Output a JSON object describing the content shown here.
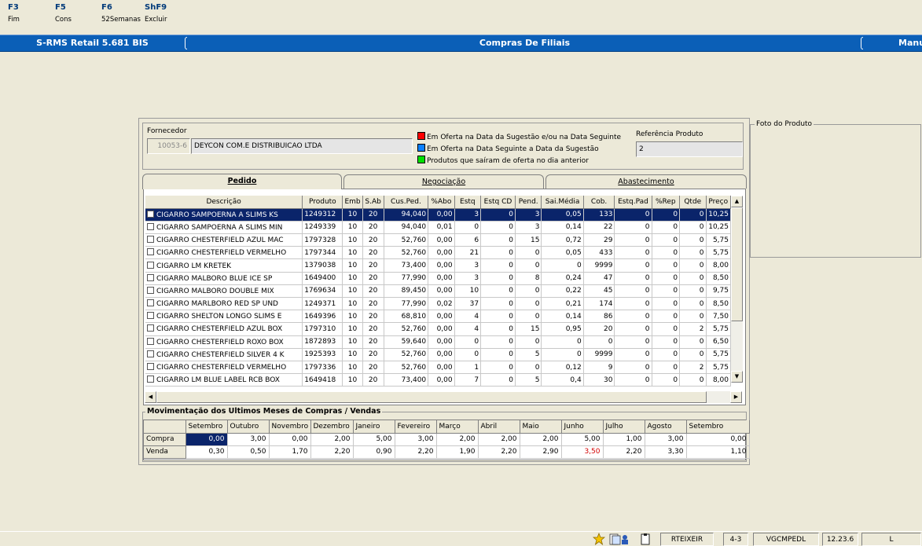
{
  "fkeys": [
    {
      "key": "F3",
      "label": "Fim"
    },
    {
      "key": "F5",
      "label": "Cons"
    },
    {
      "key": "F6",
      "label": "52Semanas"
    },
    {
      "key": "ShF9",
      "label": "Excluir"
    }
  ],
  "titlebar": {
    "app": "S-RMS Retail 5.681 BIS",
    "screen": "Compras De Filiais",
    "right": "Manu"
  },
  "fornecedor": {
    "label": "Fornecedor",
    "code": "10053-6",
    "name": "DEYCON COM.E DISTRIBUICAO LTDA"
  },
  "legend": [
    {
      "color": "#ff0000",
      "text": "Em Oferta na Data da Sugestão e/ou na Data Seguinte"
    },
    {
      "color": "#0a7fff",
      "text": "Em Oferta na Data Seguinte a Data da Sugestão"
    },
    {
      "color": "#00e000",
      "text": "Produtos que saíram de oferta no dia anterior"
    }
  ],
  "referencia": {
    "label": "Referência Produto",
    "value": "2"
  },
  "foto": {
    "label": "Foto do Produto"
  },
  "tabs": [
    "Pedido",
    "Negociação",
    "Abastecimento"
  ],
  "grid": {
    "columns": [
      "Descrição",
      "Produto",
      "Emb",
      "S.Ab",
      "Cus.Ped.",
      "%Abo",
      "Estq",
      "Estq CD",
      "Pend.",
      "Sai.Média",
      "Cob.",
      "Estq.Pad",
      "%Rep",
      "Qtde",
      "Preço"
    ],
    "rows": [
      [
        "CIGARRO SAMPOERNA A SLIMS KS",
        "1249312",
        "10",
        "20",
        "94,040",
        "0,00",
        "3",
        "0",
        "3",
        "0,05",
        "133",
        "0",
        "0",
        "0",
        "10,25"
      ],
      [
        "CIGARRO SAMPOERNA A SLIMS MIN",
        "1249339",
        "10",
        "20",
        "94,040",
        "0,01",
        "0",
        "0",
        "3",
        "0,14",
        "22",
        "0",
        "0",
        "0",
        "10,25"
      ],
      [
        "CIGARRO CHESTERFIELD AZUL MAC",
        "1797328",
        "10",
        "20",
        "52,760",
        "0,00",
        "6",
        "0",
        "15",
        "0,72",
        "29",
        "0",
        "0",
        "0",
        "5,75"
      ],
      [
        "CIGARRO CHESTERFIELD VERMELHO",
        "1797344",
        "10",
        "20",
        "52,760",
        "0,00",
        "21",
        "0",
        "0",
        "0,05",
        "433",
        "0",
        "0",
        "0",
        "5,75"
      ],
      [
        "CIGARRO LM KRETEK",
        "1379038",
        "10",
        "20",
        "73,400",
        "0,00",
        "3",
        "0",
        "0",
        "0",
        "9999",
        "0",
        "0",
        "0",
        "8,00"
      ],
      [
        "CIGARRO MALBORO BLUE ICE SP",
        "1649400",
        "10",
        "20",
        "77,990",
        "0,00",
        "3",
        "0",
        "8",
        "0,24",
        "47",
        "0",
        "0",
        "0",
        "8,50"
      ],
      [
        "CIGARRO MALBORO DOUBLE MIX",
        "1769634",
        "10",
        "20",
        "89,450",
        "0,00",
        "10",
        "0",
        "0",
        "0,22",
        "45",
        "0",
        "0",
        "0",
        "9,75"
      ],
      [
        "CIGARRO MARLBORO RED SP UND",
        "1249371",
        "10",
        "20",
        "77,990",
        "0,02",
        "37",
        "0",
        "0",
        "0,21",
        "174",
        "0",
        "0",
        "0",
        "8,50"
      ],
      [
        "CIGARRO SHELTON LONGO SLIMS E",
        "1649396",
        "10",
        "20",
        "68,810",
        "0,00",
        "4",
        "0",
        "0",
        "0,14",
        "86",
        "0",
        "0",
        "0",
        "7,50"
      ],
      [
        "CIGARRO CHESTERFIELD AZUL BOX",
        "1797310",
        "10",
        "20",
        "52,760",
        "0,00",
        "4",
        "0",
        "15",
        "0,95",
        "20",
        "0",
        "0",
        "2",
        "5,75"
      ],
      [
        "CIGARRO CHESTERFIELD ROXO BOX",
        "1872893",
        "10",
        "20",
        "59,640",
        "0,00",
        "0",
        "0",
        "0",
        "0",
        "0",
        "0",
        "0",
        "0",
        "6,50"
      ],
      [
        "CIGARRO CHESTERFIELD SILVER 4 K",
        "1925393",
        "10",
        "20",
        "52,760",
        "0,00",
        "0",
        "0",
        "5",
        "0",
        "9999",
        "0",
        "0",
        "0",
        "5,75"
      ],
      [
        "CIGARRO CHESTERFIELD VERMELHO",
        "1797336",
        "10",
        "20",
        "52,760",
        "0,00",
        "1",
        "0",
        "0",
        "0,12",
        "9",
        "0",
        "0",
        "2",
        "5,75"
      ],
      [
        "CIGARRO LM BLUE LABEL RCB BOX",
        "1649418",
        "10",
        "20",
        "73,400",
        "0,00",
        "7",
        "0",
        "5",
        "0,4",
        "30",
        "0",
        "0",
        "0",
        "8,00"
      ]
    ]
  },
  "movimentacao": {
    "title": "Movimentação dos Ultimos Meses de Compras / Vendas",
    "months": [
      "Setembro",
      "Outubro",
      "Novembro",
      "Dezembro",
      "Janeiro",
      "Fevereiro",
      "Março",
      "Abril",
      "Maio",
      "Junho",
      "Julho",
      "Agosto",
      "Setembro"
    ],
    "rows": [
      {
        "label": "Compra",
        "values": [
          "0,00",
          "3,00",
          "0,00",
          "2,00",
          "5,00",
          "3,00",
          "2,00",
          "2,00",
          "2,00",
          "5,00",
          "1,00",
          "3,00",
          "0,00"
        ]
      },
      {
        "label": "Venda",
        "values": [
          "0,30",
          "0,50",
          "1,70",
          "2,20",
          "0,90",
          "2,20",
          "1,90",
          "2,20",
          "2,90",
          "3,50",
          "2,20",
          "3,30",
          "1,10"
        ]
      }
    ],
    "highlight_color": "#d40000"
  },
  "status": {
    "user": "RTEIXEIR",
    "session": "4-3",
    "program": "VGCMPEDL",
    "time": "12.23.6",
    "mode": "L"
  }
}
